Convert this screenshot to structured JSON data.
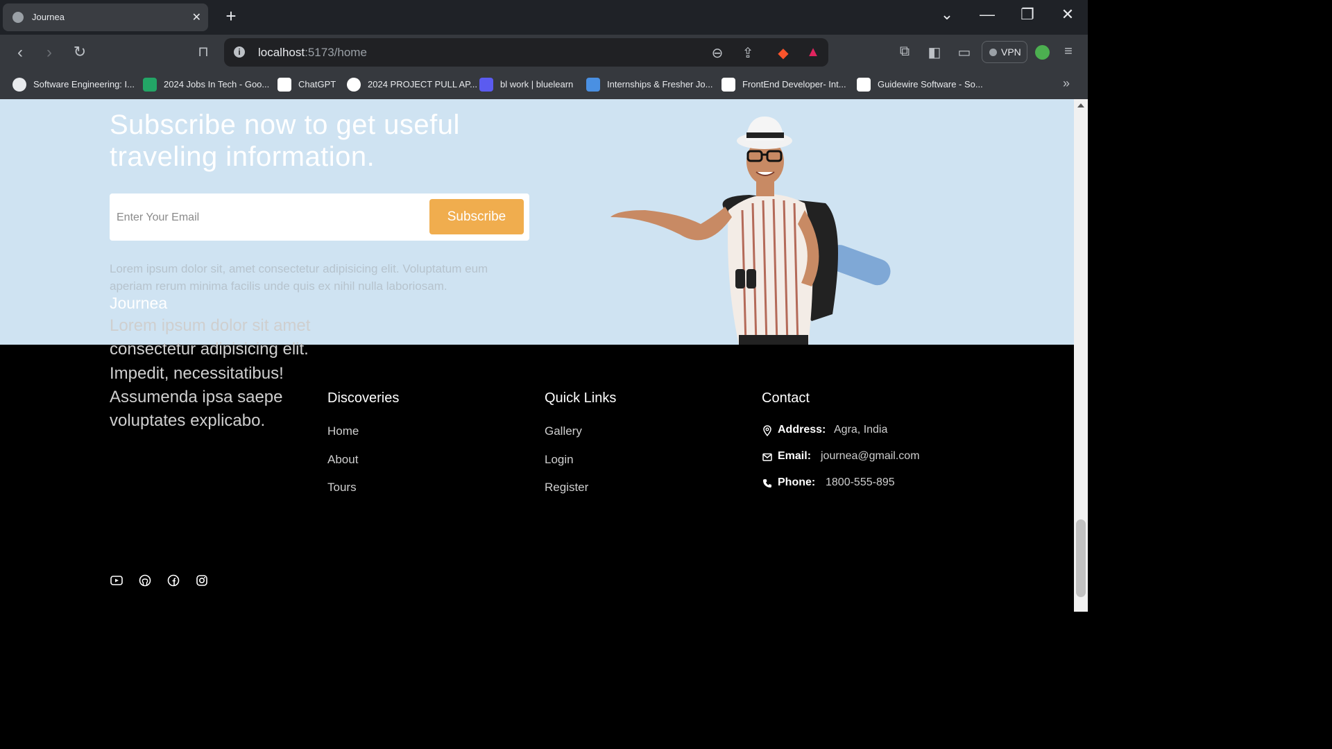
{
  "browser": {
    "tab_title": "Journea",
    "tab_close": "✕",
    "new_tab": "+",
    "url_host": "localhost",
    "url_rest": ":5173/home",
    "vpn_label": "VPN",
    "bookmarks": [
      {
        "label": "Software Engineering: I...",
        "icon_color": "#e8eaed"
      },
      {
        "label": "2024 Jobs In Tech - Goo...",
        "icon_color": "#23a566"
      },
      {
        "label": "ChatGPT",
        "icon_color": "#ffffff"
      },
      {
        "label": "2024 PROJECT PULL AP...",
        "icon_color": "#ffffff"
      },
      {
        "label": "bl work | bluelearn",
        "icon_color": "#5b5bf0"
      },
      {
        "label": "Internships & Fresher Jo...",
        "icon_color": "#4a90e2"
      },
      {
        "label": "FrontEnd Developer- Int...",
        "icon_color": "#ffffff"
      },
      {
        "label": "Guidewire Software - So...",
        "icon_color": "#ffffff"
      }
    ],
    "bookmarks_more": "»"
  },
  "subscribe": {
    "title": "Subscribe now to get useful traveling information.",
    "placeholder": "Enter Your Email",
    "button_label": "Subscribe",
    "description": "Lorem ipsum dolor sit, amet consectetur adipisicing elit. Voluptatum eum aperiam rerum minima facilis unde quis ex nihil nulla laboriosam."
  },
  "footer": {
    "brand": "Journea",
    "about": "Lorem ipsum dolor sit amet consectetur adipisicing elit. Impedit, necessitatibus! Assumenda ipsa saepe voluptates explicabo.",
    "social_icons": [
      "youtube-icon",
      "github-icon",
      "facebook-icon",
      "instagram-icon"
    ],
    "discoveries": {
      "title": "Discoveries",
      "links": [
        "Home",
        "About",
        "Tours"
      ]
    },
    "quick_links": {
      "title": "Quick Links",
      "links": [
        "Gallery",
        "Login",
        "Register"
      ]
    },
    "contact": {
      "title": "Contact",
      "rows": [
        {
          "key": "Address:",
          "value": "Agra, India",
          "icon": "location-icon"
        },
        {
          "key": "Email:",
          "value": "journea@gmail.com",
          "icon": "mail-icon"
        },
        {
          "key": "Phone:",
          "value": "1800-555-895",
          "icon": "phone-icon"
        }
      ]
    }
  },
  "colors": {
    "subscribe_bg": "#cfe3f2",
    "button": "#f0ad4e",
    "footer_bg": "#000000"
  }
}
